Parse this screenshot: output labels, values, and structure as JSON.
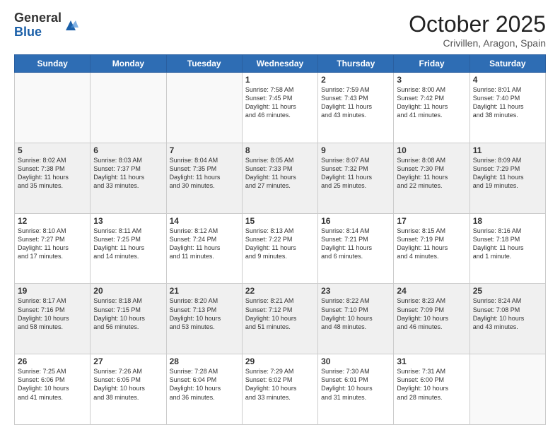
{
  "header": {
    "logo_general": "General",
    "logo_blue": "Blue",
    "month_title": "October 2025",
    "location": "Crivillen, Aragon, Spain"
  },
  "days_of_week": [
    "Sunday",
    "Monday",
    "Tuesday",
    "Wednesday",
    "Thursday",
    "Friday",
    "Saturday"
  ],
  "weeks": [
    [
      {
        "day": "",
        "info": ""
      },
      {
        "day": "",
        "info": ""
      },
      {
        "day": "",
        "info": ""
      },
      {
        "day": "1",
        "info": "Sunrise: 7:58 AM\nSunset: 7:45 PM\nDaylight: 11 hours\nand 46 minutes."
      },
      {
        "day": "2",
        "info": "Sunrise: 7:59 AM\nSunset: 7:43 PM\nDaylight: 11 hours\nand 43 minutes."
      },
      {
        "day": "3",
        "info": "Sunrise: 8:00 AM\nSunset: 7:42 PM\nDaylight: 11 hours\nand 41 minutes."
      },
      {
        "day": "4",
        "info": "Sunrise: 8:01 AM\nSunset: 7:40 PM\nDaylight: 11 hours\nand 38 minutes."
      }
    ],
    [
      {
        "day": "5",
        "info": "Sunrise: 8:02 AM\nSunset: 7:38 PM\nDaylight: 11 hours\nand 35 minutes."
      },
      {
        "day": "6",
        "info": "Sunrise: 8:03 AM\nSunset: 7:37 PM\nDaylight: 11 hours\nand 33 minutes."
      },
      {
        "day": "7",
        "info": "Sunrise: 8:04 AM\nSunset: 7:35 PM\nDaylight: 11 hours\nand 30 minutes."
      },
      {
        "day": "8",
        "info": "Sunrise: 8:05 AM\nSunset: 7:33 PM\nDaylight: 11 hours\nand 27 minutes."
      },
      {
        "day": "9",
        "info": "Sunrise: 8:07 AM\nSunset: 7:32 PM\nDaylight: 11 hours\nand 25 minutes."
      },
      {
        "day": "10",
        "info": "Sunrise: 8:08 AM\nSunset: 7:30 PM\nDaylight: 11 hours\nand 22 minutes."
      },
      {
        "day": "11",
        "info": "Sunrise: 8:09 AM\nSunset: 7:29 PM\nDaylight: 11 hours\nand 19 minutes."
      }
    ],
    [
      {
        "day": "12",
        "info": "Sunrise: 8:10 AM\nSunset: 7:27 PM\nDaylight: 11 hours\nand 17 minutes."
      },
      {
        "day": "13",
        "info": "Sunrise: 8:11 AM\nSunset: 7:25 PM\nDaylight: 11 hours\nand 14 minutes."
      },
      {
        "day": "14",
        "info": "Sunrise: 8:12 AM\nSunset: 7:24 PM\nDaylight: 11 hours\nand 11 minutes."
      },
      {
        "day": "15",
        "info": "Sunrise: 8:13 AM\nSunset: 7:22 PM\nDaylight: 11 hours\nand 9 minutes."
      },
      {
        "day": "16",
        "info": "Sunrise: 8:14 AM\nSunset: 7:21 PM\nDaylight: 11 hours\nand 6 minutes."
      },
      {
        "day": "17",
        "info": "Sunrise: 8:15 AM\nSunset: 7:19 PM\nDaylight: 11 hours\nand 4 minutes."
      },
      {
        "day": "18",
        "info": "Sunrise: 8:16 AM\nSunset: 7:18 PM\nDaylight: 11 hours\nand 1 minute."
      }
    ],
    [
      {
        "day": "19",
        "info": "Sunrise: 8:17 AM\nSunset: 7:16 PM\nDaylight: 10 hours\nand 58 minutes."
      },
      {
        "day": "20",
        "info": "Sunrise: 8:18 AM\nSunset: 7:15 PM\nDaylight: 10 hours\nand 56 minutes."
      },
      {
        "day": "21",
        "info": "Sunrise: 8:20 AM\nSunset: 7:13 PM\nDaylight: 10 hours\nand 53 minutes."
      },
      {
        "day": "22",
        "info": "Sunrise: 8:21 AM\nSunset: 7:12 PM\nDaylight: 10 hours\nand 51 minutes."
      },
      {
        "day": "23",
        "info": "Sunrise: 8:22 AM\nSunset: 7:10 PM\nDaylight: 10 hours\nand 48 minutes."
      },
      {
        "day": "24",
        "info": "Sunrise: 8:23 AM\nSunset: 7:09 PM\nDaylight: 10 hours\nand 46 minutes."
      },
      {
        "day": "25",
        "info": "Sunrise: 8:24 AM\nSunset: 7:08 PM\nDaylight: 10 hours\nand 43 minutes."
      }
    ],
    [
      {
        "day": "26",
        "info": "Sunrise: 7:25 AM\nSunset: 6:06 PM\nDaylight: 10 hours\nand 41 minutes."
      },
      {
        "day": "27",
        "info": "Sunrise: 7:26 AM\nSunset: 6:05 PM\nDaylight: 10 hours\nand 38 minutes."
      },
      {
        "day": "28",
        "info": "Sunrise: 7:28 AM\nSunset: 6:04 PM\nDaylight: 10 hours\nand 36 minutes."
      },
      {
        "day": "29",
        "info": "Sunrise: 7:29 AM\nSunset: 6:02 PM\nDaylight: 10 hours\nand 33 minutes."
      },
      {
        "day": "30",
        "info": "Sunrise: 7:30 AM\nSunset: 6:01 PM\nDaylight: 10 hours\nand 31 minutes."
      },
      {
        "day": "31",
        "info": "Sunrise: 7:31 AM\nSunset: 6:00 PM\nDaylight: 10 hours\nand 28 minutes."
      },
      {
        "day": "",
        "info": ""
      }
    ]
  ]
}
